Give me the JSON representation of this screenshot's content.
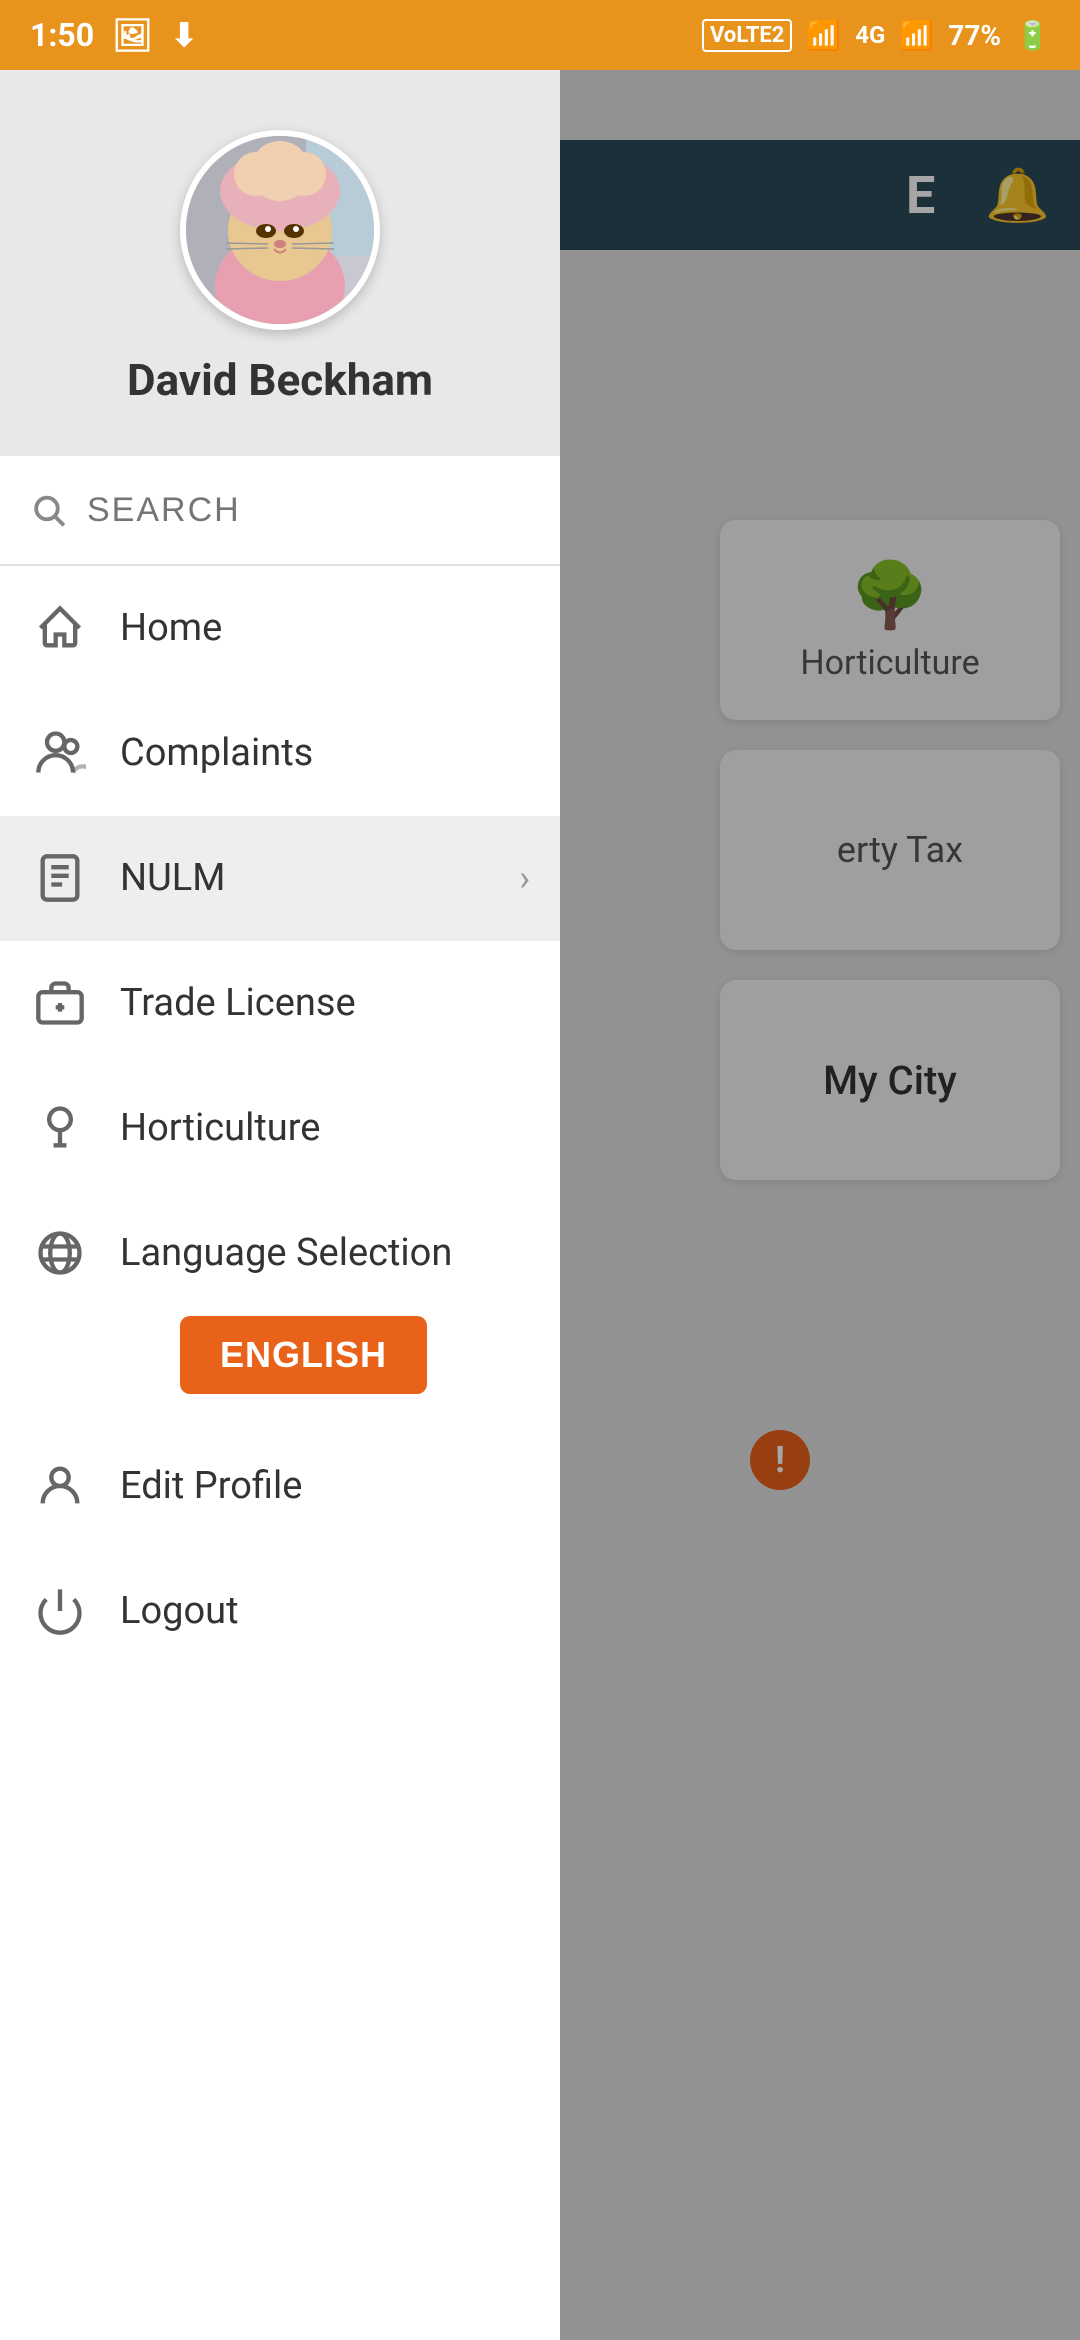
{
  "statusBar": {
    "time": "1:50",
    "battery": "77%",
    "signal": "VoLTE2"
  },
  "profile": {
    "name": "David Beckham",
    "avatarEmoji": "🐱"
  },
  "search": {
    "placeholder": "SEARCH"
  },
  "menu": {
    "items": [
      {
        "id": "home",
        "label": "Home",
        "icon": "home",
        "hasChevron": false,
        "active": false
      },
      {
        "id": "complaints",
        "label": "Complaints",
        "icon": "complaints",
        "hasChevron": false,
        "active": false
      },
      {
        "id": "nulm",
        "label": "NULM",
        "icon": "nulm",
        "hasChevron": true,
        "active": true
      },
      {
        "id": "trade-license",
        "label": "Trade License",
        "icon": "trade",
        "hasChevron": false,
        "active": false
      },
      {
        "id": "horticulture",
        "label": "Horticulture",
        "icon": "horticulture",
        "hasChevron": false,
        "active": false
      }
    ]
  },
  "language": {
    "label": "Language Selection",
    "currentLanguage": "ENGLISH",
    "icon": "globe"
  },
  "editProfile": {
    "label": "Edit Profile",
    "icon": "person"
  },
  "logout": {
    "label": "Logout",
    "icon": "power"
  },
  "backgroundContent": {
    "horticulture": "Horticulture",
    "propertyTax": "erty Tax",
    "myCity": "My City"
  },
  "colors": {
    "accent": "#E8621A",
    "topBar": "#E8931B",
    "activeMenu": "#eeeeee"
  }
}
